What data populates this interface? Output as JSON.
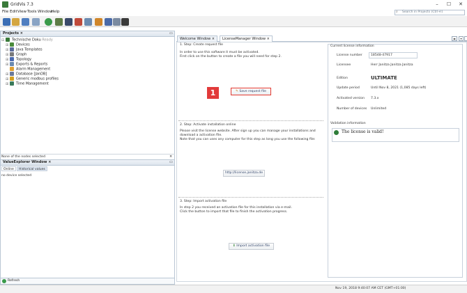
{
  "window": {
    "title": "GridVis 7.3",
    "minimize": "–",
    "maximize": "☐",
    "close": "✕"
  },
  "menu": [
    "File",
    "Edit",
    "View",
    "Tools",
    "Window",
    "Help"
  ],
  "search": {
    "placeholder": "Search in Projects (Ctrl+I)"
  },
  "projects": {
    "header": "Projects ×",
    "root": "Technische Doku",
    "root_status": "Ready",
    "items": [
      {
        "label": "Devices",
        "icon_color": "#4a8a3a"
      },
      {
        "label": "Java Templates",
        "icon_color": "#5a6a9a"
      },
      {
        "label": "Graph",
        "icon_color": "#7a7a7a"
      },
      {
        "label": "Topology",
        "icon_color": "#4a6ab0"
      },
      {
        "label": "Exports & Reports",
        "icon_color": "#6a8ab0"
      },
      {
        "label": "Alarm Management",
        "icon_color": "#e0a030"
      },
      {
        "label": "Database [JanDB]",
        "icon_color": "#6a7a9a"
      },
      {
        "label": "Generic modbus profiles",
        "icon_color": "#d4a020"
      },
      {
        "label": "Time Management",
        "icon_color": "#3a7a5a"
      }
    ],
    "selection_status": "None of the nodes selected"
  },
  "value_explorer": {
    "header": "ValueExplorer Window ×",
    "tabs": [
      "Online",
      "Historical values"
    ],
    "status": "no device selected",
    "refresh": "Refresh"
  },
  "editor_tabs": [
    {
      "label": "Welcome Window ×",
      "active": false
    },
    {
      "label": "LicenseManager Window ×",
      "active": true
    }
  ],
  "step1": {
    "title": "1. Step: Create request file",
    "text1": "In order to use this software it must be activated.",
    "text2": "First click on the button to create a file you will need for step 2.",
    "button": "Save request file",
    "badge": "1"
  },
  "step2": {
    "title": "2. Step: Activate installation online",
    "text1": "Please  visit the license website. After sign up you can manage your installations and",
    "text2": "download a activation file.",
    "text3": "Note that you can uses any computer for this step as long you use the following file:",
    "link_button": "http://license.janitza.de"
  },
  "step3": {
    "title": "3. Step: Import activation file",
    "text1": "In step 2 you received an activation file for this installation via e-mail.",
    "text2": "Click the button to import that file to finish the activation progress.",
    "button": "Import activation file"
  },
  "license": {
    "title": "Current license information",
    "rows": [
      {
        "label": "License number",
        "value": "18548-47917"
      },
      {
        "label": "Licensee",
        "value": "Herr  Janitza Janitza  Janitza"
      },
      {
        "label": "Edition",
        "value": "ULTIMATE"
      },
      {
        "label": "Update period",
        "value": "Until Nov 8, 2021 (1,085 days left)"
      },
      {
        "label": "Activated version",
        "value": "7.3.x"
      },
      {
        "label": "Number of devices",
        "value": "Unlimited"
      }
    ],
    "validation_title": "Validation information",
    "validation_text": "The license is valid!"
  },
  "statusbar": {
    "datetime": "Nov 19, 2018 9:40:07 AM CET (GMT+01:00)"
  }
}
